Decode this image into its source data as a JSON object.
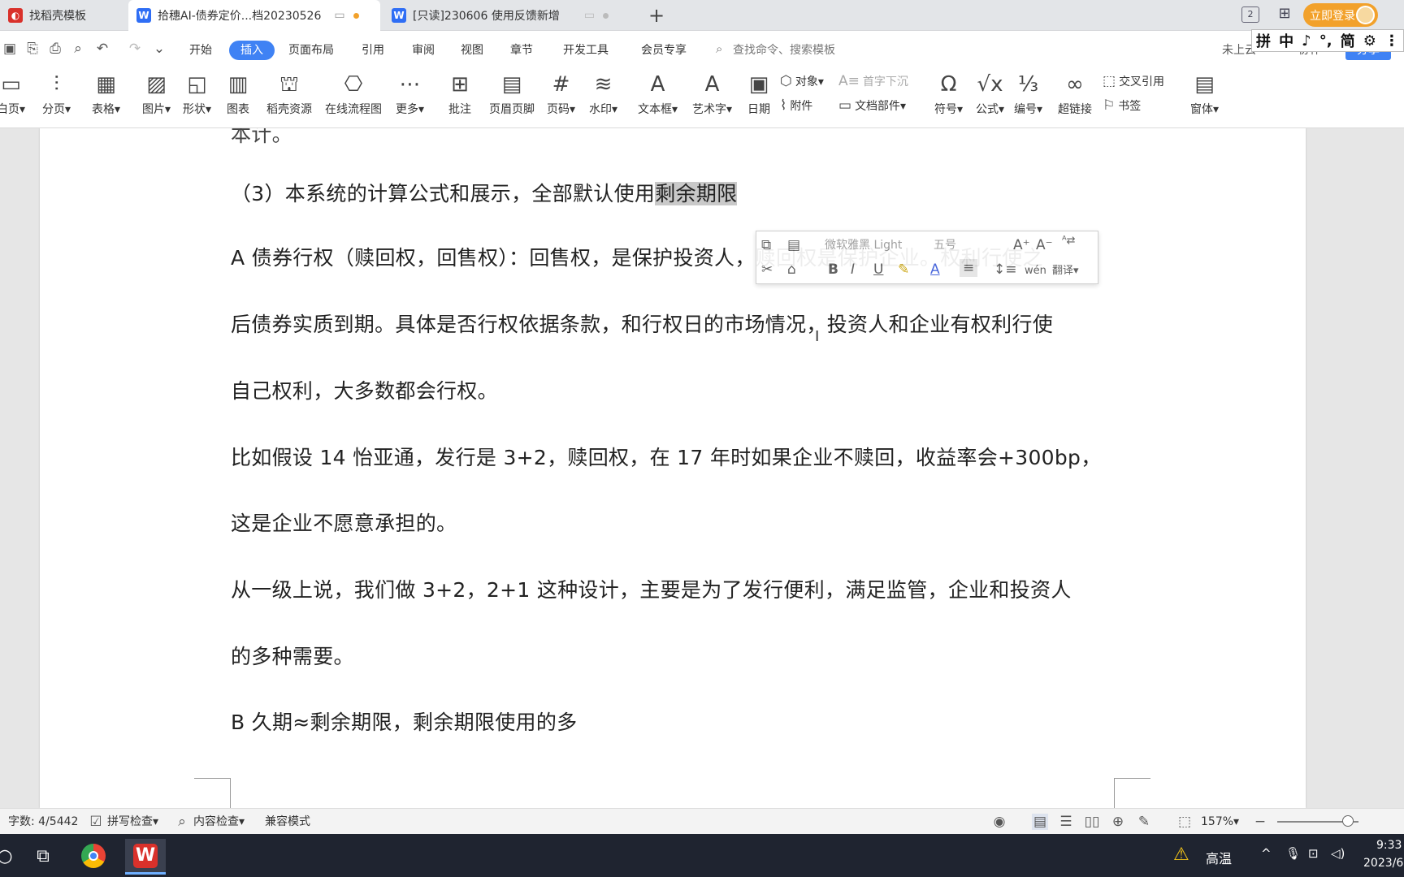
{
  "tabs": [
    {
      "label": "找稻壳模板",
      "icon_color": "#d9312b",
      "icon": "daoke-icon"
    },
    {
      "label": "拾穗AI-债券定价...档20230526",
      "icon_color": "#2f6ef5",
      "icon": "wps-writer-icon",
      "modified_dot_color": "#f2a12b"
    },
    {
      "label": "[只读]230606 使用反馈新增",
      "icon_color": "#2f6ef5",
      "icon": "wps-writer-icon"
    }
  ],
  "tab_add": "+",
  "login_label": "立即登录",
  "top_icons": {
    "window_count": "2"
  },
  "menu": {
    "items": [
      "开始",
      "插入",
      "页面布局",
      "引用",
      "审阅",
      "视图",
      "章节",
      "开发工具",
      "会员专享"
    ],
    "active": "插入",
    "search_placeholder": "查找命令、搜索模板",
    "right_items": [
      "未上云",
      "协作",
      "分享"
    ]
  },
  "ime": [
    "拼",
    "中",
    "♪",
    "°,",
    "简",
    "⚙",
    "⋮"
  ],
  "ribbon": {
    "large": [
      {
        "label": "白页▾",
        "glyph": "▭"
      },
      {
        "label": "分页▾",
        "glyph": "⫶"
      },
      {
        "label": "表格▾",
        "glyph": "▦"
      },
      {
        "label": "图片▾",
        "glyph": "▨"
      },
      {
        "label": "形状▾",
        "glyph": "◱"
      },
      {
        "label": "图表",
        "glyph": "▥"
      },
      {
        "label": "稻壳资源",
        "glyph": "⛫"
      },
      {
        "label": "在线流程图",
        "glyph": "⎔"
      },
      {
        "label": "更多▾",
        "glyph": "⋯"
      },
      {
        "label": "批注",
        "glyph": "⊞"
      },
      {
        "label": "页眉页脚",
        "glyph": "▤"
      },
      {
        "label": "页码▾",
        "glyph": "#"
      },
      {
        "label": "水印▾",
        "glyph": "≋"
      },
      {
        "label": "文本框▾",
        "glyph": "A"
      },
      {
        "label": "艺术字▾",
        "glyph": "A"
      },
      {
        "label": "日期",
        "glyph": "▣"
      },
      {
        "label": "符号▾",
        "glyph": "Ω"
      },
      {
        "label": "公式▾",
        "glyph": "√x"
      },
      {
        "label": "编号▾",
        "glyph": "⅓"
      },
      {
        "label": "超链接",
        "glyph": "∞"
      },
      {
        "label": "窗体▾",
        "glyph": "▤"
      }
    ],
    "small": {
      "object": "对象▾",
      "dropcap": "首字下沉",
      "attachment": "附件",
      "docpart": "文档部件▾",
      "crossref": "交叉引用",
      "bookmark": "书签"
    }
  },
  "document": {
    "paragraphs": [
      "本计。",
      "（3）本系统的计算公式和展示，全部默认使用",
      "A 债券行权（赎回权，回售权）：回售权，是保护投资人，赎回权是保护企业。权利行使之",
      "后债券实质到期。具体是否行权依据条款，和行权日的市场情况，投资人和企业有权利行使",
      "自己权利，大多数都会行权。",
      "比如假设 14 怡亚通，发行是 3+2，赎回权，在 17 年时如果企业不赎回，收益率会+300bp，",
      "这是企业不愿意承担的。",
      "从一级上说，我们做 3+2，2+1 这种设计，主要是为了发行便利，满足监管，企业和投资人",
      "的多种需要。",
      "B 久期≈剩余期限，剩余期限使用的多"
    ],
    "selected_text": "剩余期限",
    "selection_color": "#c9c9c9"
  },
  "floatbar": {
    "font_name": "微软雅黑 Light",
    "font_size": "五号",
    "translate_label": "翻译▾",
    "pinyin_label": "wén"
  },
  "status": {
    "word_count": "字数: 4/5442",
    "spell_check": "拼写检查▾",
    "content_check": "内容检查▾",
    "compat_mode": "兼容模式",
    "zoom": "157%▾",
    "zoom_fraction": 0.87
  },
  "taskbar": {
    "weather": "高温",
    "time": "9:33",
    "date": "2023/6"
  },
  "colors": {
    "accent": "#3f82f4",
    "login": "#f2a12b",
    "taskbar": "#1f2430",
    "warning": "#f5c518"
  }
}
